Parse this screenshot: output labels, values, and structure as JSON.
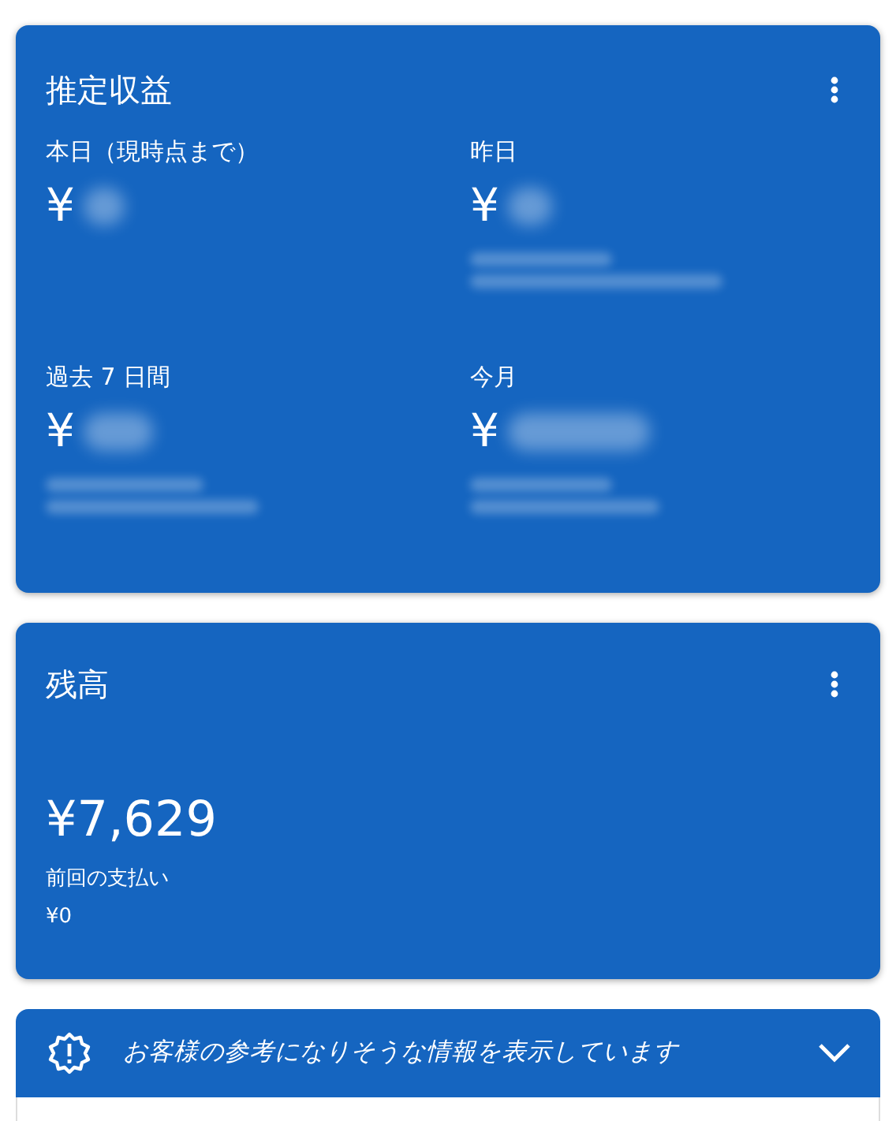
{
  "earnings_card": {
    "title": "推定収益",
    "metrics": [
      {
        "label": "本日（現時点まで）",
        "currency": "¥",
        "value_blurred": true,
        "comparison_blurred": false
      },
      {
        "label": "昨日",
        "currency": "¥",
        "value_blurred": true,
        "comparison_blurred": true
      },
      {
        "label": "過去 7 日間",
        "currency": "¥",
        "value_blurred": true,
        "comparison_blurred": true
      },
      {
        "label": "今月",
        "currency": "¥",
        "value_blurred": true,
        "comparison_blurred": true
      }
    ]
  },
  "balance_card": {
    "title": "残高",
    "amount": "¥7,629",
    "last_payment_label": "前回の支払い",
    "last_payment_amount": "¥0"
  },
  "info_banner": {
    "text": "お客様の参考になりそうな情報を表示しています",
    "expanded": false
  }
}
